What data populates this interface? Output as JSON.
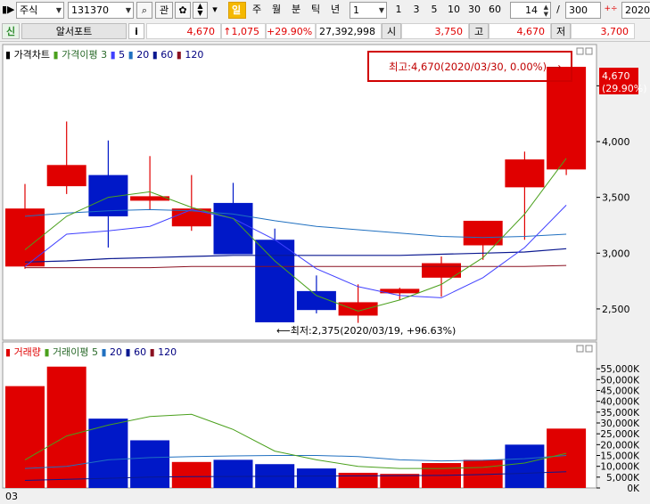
{
  "toolbar": {
    "market": "주식",
    "code": "131370",
    "search_icon": "magnifier-icon",
    "watch_label": "관",
    "periods": [
      "일",
      "주",
      "월",
      "분",
      "틱",
      "년"
    ],
    "active_period": "일",
    "interval": "1",
    "minute_options": [
      "1",
      "3",
      "5",
      "10",
      "30",
      "60"
    ],
    "count": "14",
    "count_separator": "/",
    "total": "300",
    "date": "2020/"
  },
  "infobar": {
    "badge": "신",
    "name": "알서포트",
    "info_label": "i",
    "price": "4,670",
    "change": "↑1,075",
    "change_pct": "+29.90%",
    "volume": "27,392,998",
    "open_label": "시",
    "open": "3,750",
    "high_label": "고",
    "high": "4,670",
    "low_label": "저",
    "low": "3,700"
  },
  "price_legend": {
    "title": "가격차트",
    "ma_label": "가격이평",
    "periods": [
      "3",
      "5",
      "20",
      "60",
      "120"
    ]
  },
  "volume_legend": {
    "title": "거래량",
    "ma_label": "거래이평",
    "periods": [
      "5",
      "20",
      "60",
      "120"
    ]
  },
  "annotations": {
    "high": "최고:4,670(2020/03/30, 0.00%)⟶",
    "low": "⟵최저:2,375(2020/03/19, +96.63%)",
    "last_price": "4,670",
    "last_pct": "(29.90%)"
  },
  "footer": {
    "date_label": "03"
  },
  "colors": {
    "up": "#e00000",
    "down": "#0018c8",
    "ma3": "#4aa01c",
    "ma5": "#4040ff",
    "ma20": "#2070c0",
    "ma60": "#0a1890",
    "ma120": "#8a1020",
    "vma5": "#4aa01c",
    "vma20": "#2070c0",
    "vma60": "#0a1890"
  },
  "chart_data": [
    {
      "type": "candlestick",
      "y_ticks": [
        "2,500",
        "3,000",
        "3,500",
        "4,000",
        "4,500"
      ],
      "y_tick_values": [
        2500,
        3000,
        3500,
        4000,
        4500
      ],
      "ylim": [
        2220,
        4870
      ],
      "candles": [
        {
          "open": 2880,
          "high": 3620,
          "low": 2860,
          "close": 3400
        },
        {
          "open": 3600,
          "high": 4180,
          "low": 3530,
          "close": 3790
        },
        {
          "open": 3700,
          "high": 4010,
          "low": 3050,
          "close": 3330
        },
        {
          "open": 3470,
          "high": 3870,
          "low": 3390,
          "close": 3510
        },
        {
          "open": 3240,
          "high": 3700,
          "low": 3200,
          "close": 3400
        },
        {
          "open": 3450,
          "high": 3630,
          "low": 2990,
          "close": 2990
        },
        {
          "open": 3120,
          "high": 3220,
          "low": 2380,
          "close": 2380
        },
        {
          "open": 2660,
          "high": 2800,
          "low": 2460,
          "close": 2490
        },
        {
          "open": 2440,
          "high": 2720,
          "low": 2375,
          "close": 2560
        },
        {
          "open": 2640,
          "high": 2690,
          "low": 2580,
          "close": 2680
        },
        {
          "open": 2780,
          "high": 2970,
          "low": 2610,
          "close": 2910
        },
        {
          "open": 3070,
          "high": 3290,
          "low": 2940,
          "close": 3290
        },
        {
          "open": 3590,
          "high": 3910,
          "low": 3120,
          "close": 3840
        },
        {
          "open": 3750,
          "high": 4670,
          "low": 3700,
          "close": 4670
        }
      ],
      "ma3": [
        3030,
        3330,
        3500,
        3550,
        3410,
        3310,
        2930,
        2620,
        2480,
        2580,
        2720,
        2960,
        3350,
        3850
      ],
      "ma5": [
        2880,
        3170,
        3200,
        3240,
        3390,
        3310,
        3120,
        2860,
        2700,
        2620,
        2600,
        2780,
        3050,
        3430
      ],
      "ma20": [
        3330,
        3360,
        3380,
        3390,
        3380,
        3350,
        3290,
        3240,
        3210,
        3180,
        3150,
        3140,
        3150,
        3170
      ],
      "ma60": [
        2920,
        2930,
        2950,
        2960,
        2970,
        2980,
        2980,
        2980,
        2980,
        2980,
        2990,
        3000,
        3010,
        3040
      ],
      "ma120": [
        2870,
        2870,
        2870,
        2870,
        2880,
        2880,
        2880,
        2880,
        2880,
        2880,
        2880,
        2880,
        2880,
        2890
      ]
    },
    {
      "type": "bar",
      "y_ticks": [
        "55,000K",
        "50,000K",
        "45,000K",
        "40,000K",
        "35,000K",
        "30,000K",
        "25,000K",
        "20,000K",
        "15,000K",
        "10,000K",
        "5,000K",
        "0K"
      ],
      "y_tick_values": [
        55000,
        50000,
        45000,
        40000,
        35000,
        30000,
        25000,
        20000,
        15000,
        10000,
        5000,
        0
      ],
      "ylim": [
        0,
        60000
      ],
      "values": [
        47000,
        56000,
        32000,
        22000,
        12000,
        13000,
        11000,
        9000,
        7000,
        6500,
        11500,
        13000,
        20000,
        27400
      ],
      "up": [
        true,
        true,
        false,
        false,
        true,
        false,
        false,
        false,
        true,
        true,
        true,
        true,
        false,
        true
      ],
      "vma5": [
        13000,
        24000,
        29000,
        33000,
        34000,
        27000,
        17000,
        13000,
        10000,
        9000,
        9000,
        9500,
        11500,
        16000
      ],
      "vma20": [
        9000,
        10000,
        13000,
        14000,
        14500,
        14800,
        15000,
        15000,
        14500,
        13000,
        12500,
        12800,
        13500,
        15000
      ],
      "vma60": [
        3500,
        4000,
        4500,
        5000,
        5200,
        5300,
        5400,
        5500,
        5600,
        5700,
        5800,
        6200,
        6800,
        7500
      ]
    }
  ]
}
